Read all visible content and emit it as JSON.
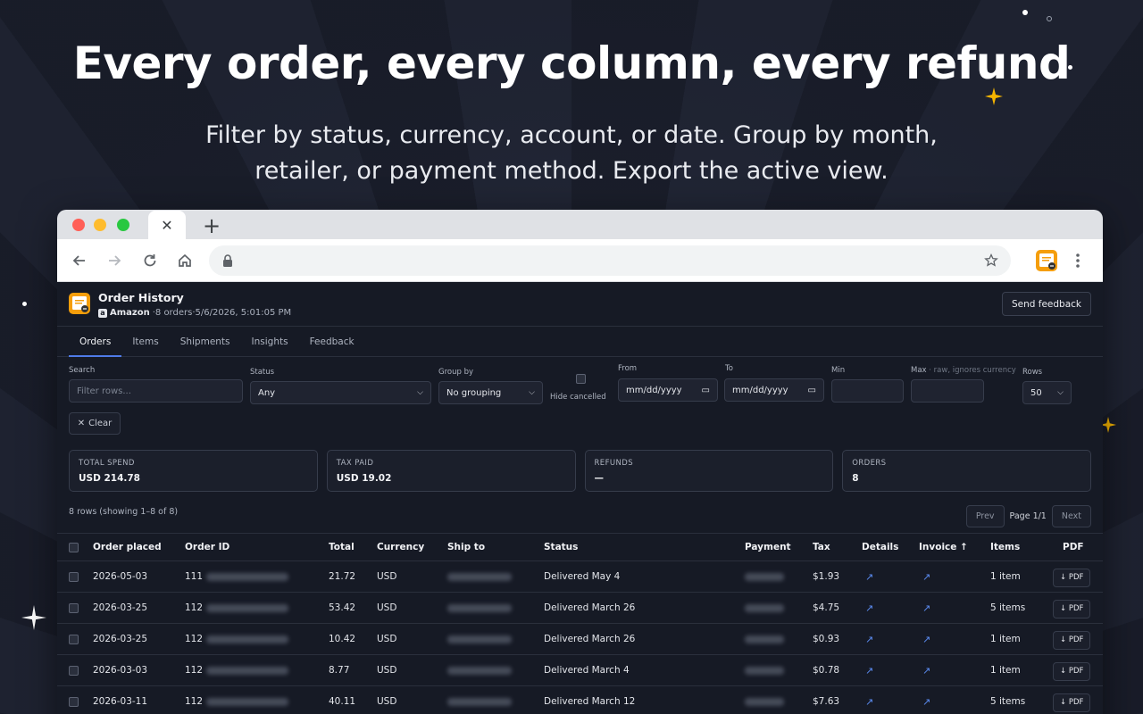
{
  "hero": {
    "headline": "Every order, every column, every refund",
    "subline": "Filter by status, currency, account, or date. Group by month, retailer, or payment method. Export the active view."
  },
  "browser": {
    "tab_close": "✕",
    "new_tab": "+"
  },
  "app": {
    "title": "Order History",
    "retailer": "Amazon",
    "meta": "·8 orders·5/6/2026, 5:01:05 PM",
    "feedback_button": "Send feedback",
    "tabs": [
      "Orders",
      "Items",
      "Shipments",
      "Insights",
      "Feedback"
    ],
    "active_tab": "Orders"
  },
  "filters": {
    "search_label": "Search",
    "search_placeholder": "Filter rows...",
    "status_label": "Status",
    "status_value": "Any",
    "groupby_label": "Group by",
    "groupby_value": "No grouping",
    "hide_cancelled_label": "Hide cancelled",
    "from_label": "From",
    "from_value": "mm/dd/yyyy",
    "to_label": "To",
    "to_value": "mm/dd/yyyy",
    "min_label": "Min",
    "max_label": "Max",
    "max_note": "· raw, ignores currency",
    "rows_label": "Rows",
    "rows_value": "50",
    "clear_button": "Clear"
  },
  "summary": [
    {
      "label": "TOTAL SPEND",
      "value": "USD 214.78"
    },
    {
      "label": "TAX PAID",
      "value": "USD 19.02"
    },
    {
      "label": "REFUNDS",
      "value": "—"
    },
    {
      "label": "ORDERS",
      "value": "8"
    }
  ],
  "pagination": {
    "rows_info": "8 rows (showing 1–8 of 8)",
    "prev": "Prev",
    "page": "Page 1/1",
    "next": "Next"
  },
  "table": {
    "headers": {
      "order_placed": "Order placed",
      "order_id": "Order ID",
      "total": "Total",
      "currency": "Currency",
      "ship_to": "Ship to",
      "status": "Status",
      "payment": "Payment",
      "tax": "Tax",
      "details": "Details",
      "invoice": "Invoice ↑",
      "items": "Items",
      "pdf": "PDF"
    },
    "rows": [
      {
        "date": "2026-05-03",
        "id_prefix": "111",
        "total": "21.72",
        "currency": "USD",
        "status": "Delivered May 4",
        "tax": "$1.93",
        "items": "1 item",
        "pdf": "↓ PDF"
      },
      {
        "date": "2026-03-25",
        "id_prefix": "112",
        "total": "53.42",
        "currency": "USD",
        "status": "Delivered March 26",
        "tax": "$4.75",
        "items": "5 items",
        "pdf": "↓ PDF"
      },
      {
        "date": "2026-03-25",
        "id_prefix": "112",
        "total": "10.42",
        "currency": "USD",
        "status": "Delivered March 26",
        "tax": "$0.93",
        "items": "1 item",
        "pdf": "↓ PDF"
      },
      {
        "date": "2026-03-03",
        "id_prefix": "112",
        "total": "8.77",
        "currency": "USD",
        "status": "Delivered March 4",
        "tax": "$0.78",
        "items": "1 item",
        "pdf": "↓ PDF"
      },
      {
        "date": "2026-03-11",
        "id_prefix": "112",
        "total": "40.11",
        "currency": "USD",
        "status": "Delivered March 12",
        "tax": "$7.63",
        "items": "5 items",
        "pdf": "↓ PDF"
      }
    ],
    "link_glyph": "↗"
  },
  "colors": {
    "accent": "#4f7be8",
    "link": "#5b8bf0",
    "spark": "#f5b400",
    "extension_orange": "#f59e0b"
  }
}
